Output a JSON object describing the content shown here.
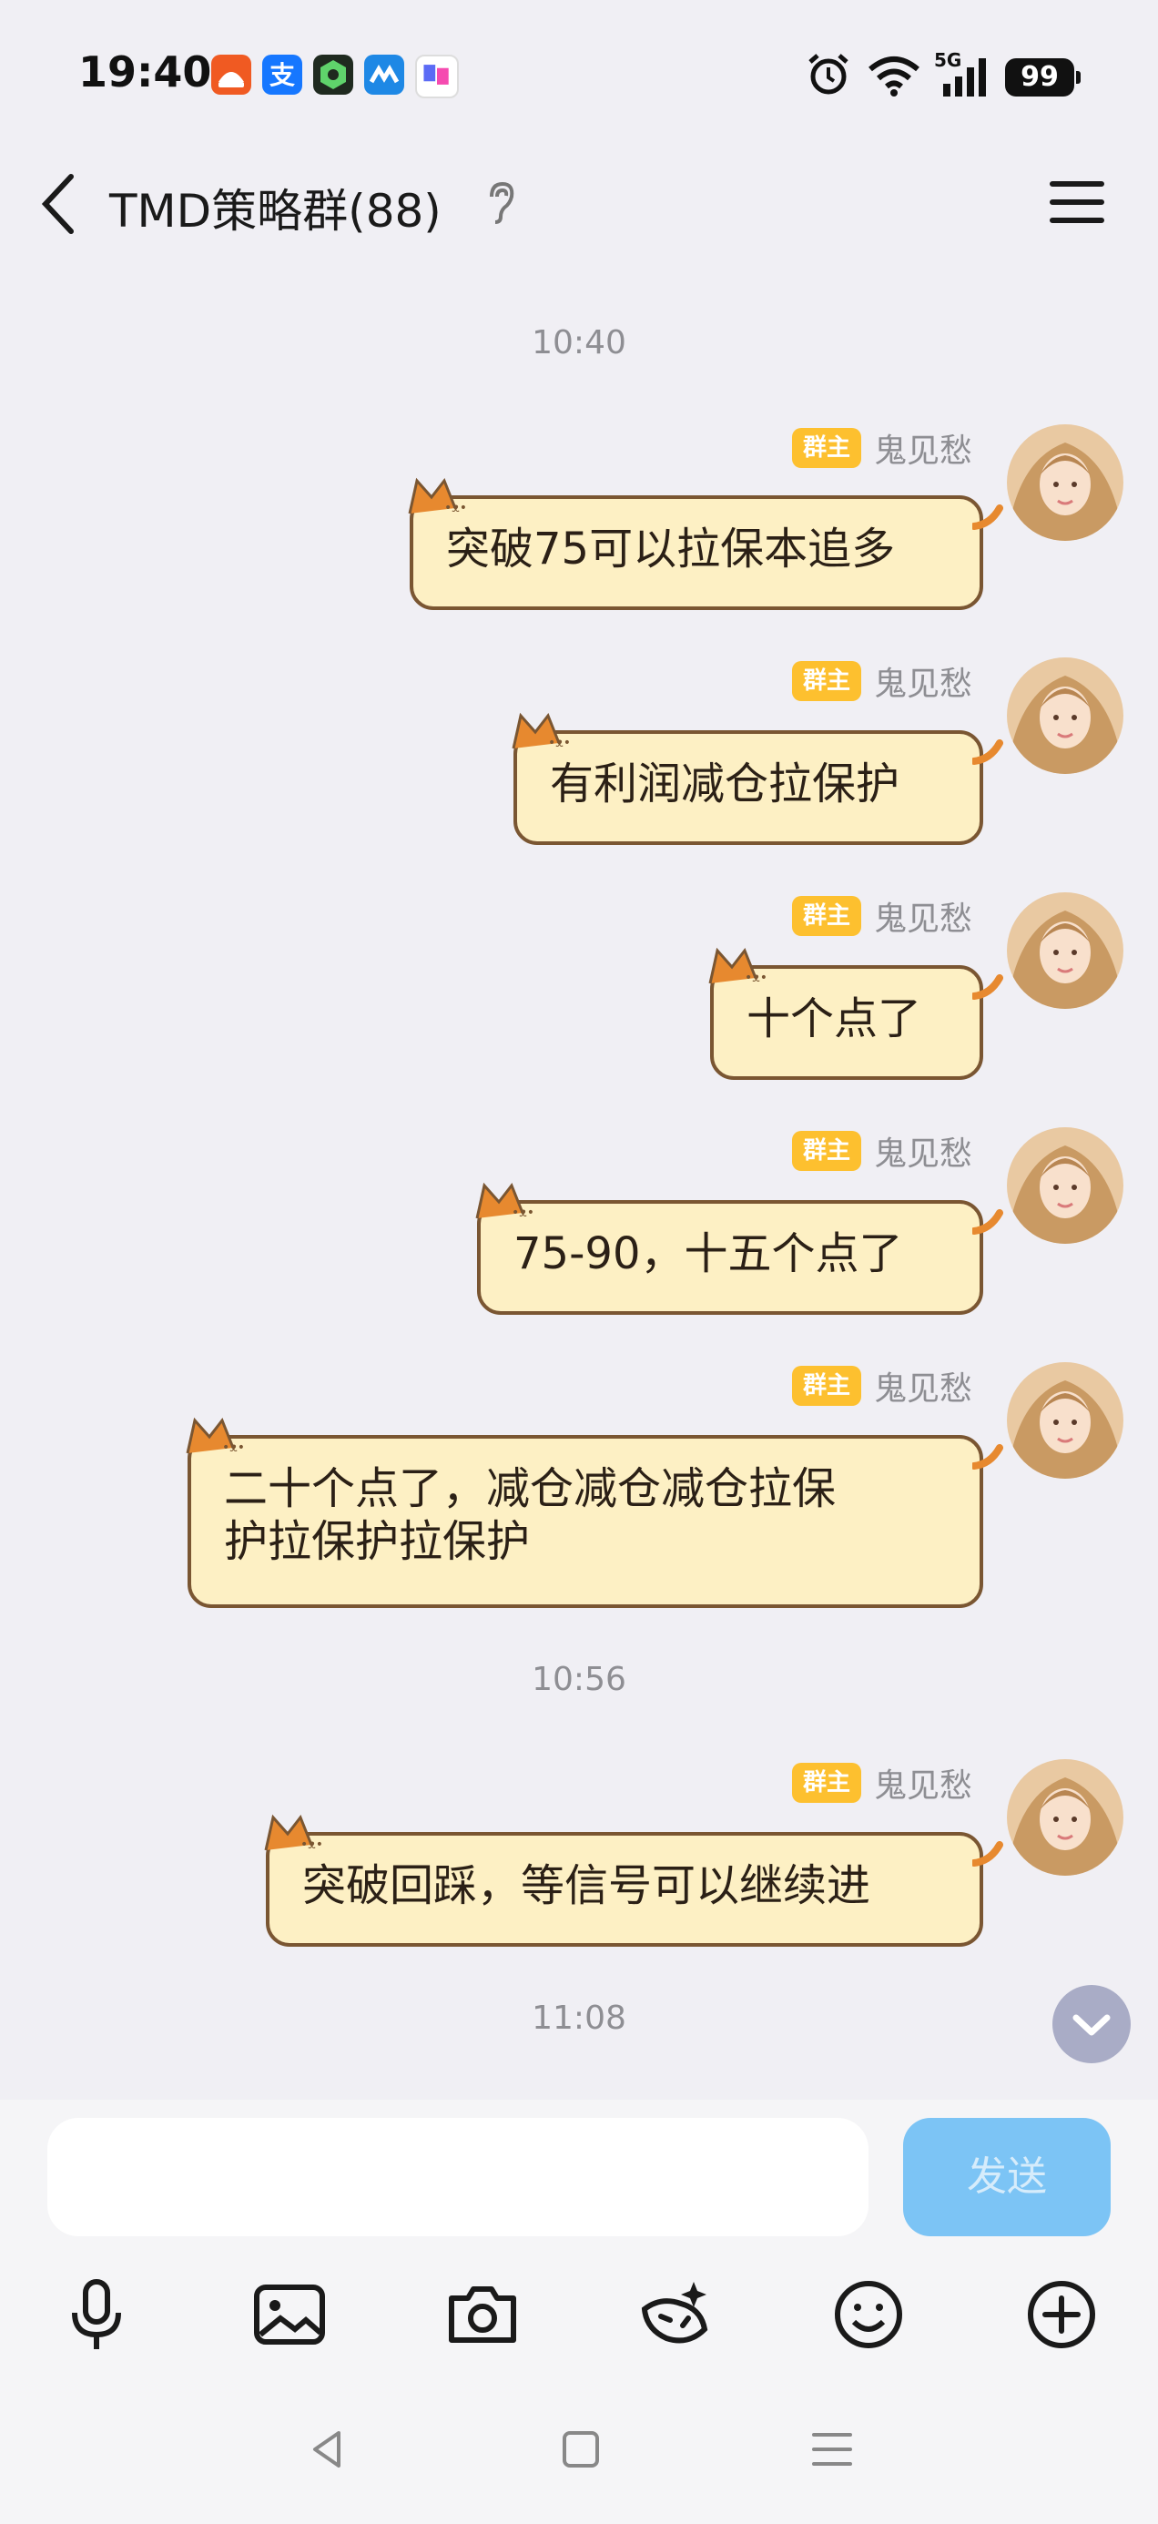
{
  "status_bar": {
    "time": "19:40",
    "battery": "99",
    "network": "5G",
    "app_icons": [
      "taobao-icon",
      "alipay-icon",
      "green-hex-app-icon",
      "blue-app-icon",
      "mixed-app-icon"
    ],
    "system_icons": [
      "alarm-icon",
      "wifi-icon",
      "signal-icon",
      "battery-icon"
    ]
  },
  "header": {
    "title": "TMD策略群(88)",
    "icons": [
      "back-icon",
      "ear-icon",
      "menu-icon"
    ]
  },
  "messages": [
    {
      "type": "time",
      "text": "10:40"
    },
    {
      "type": "msg",
      "badge": "群主",
      "sender": "鬼见愁",
      "text": "突破75可以拉保本追多"
    },
    {
      "type": "msg",
      "badge": "群主",
      "sender": "鬼见愁",
      "text": "有利润减仓拉保护"
    },
    {
      "type": "msg",
      "badge": "群主",
      "sender": "鬼见愁",
      "text": "十个点了"
    },
    {
      "type": "msg",
      "badge": "群主",
      "sender": "鬼见愁",
      "text": "75-90，十五个点了"
    },
    {
      "type": "msg",
      "badge": "群主",
      "sender": "鬼见愁",
      "text_line1": "二十个点了，减仓减仓减仓拉保",
      "text_line2": "护拉保护拉保护"
    },
    {
      "type": "time",
      "text": "10:56"
    },
    {
      "type": "msg",
      "badge": "群主",
      "sender": "鬼见愁",
      "text": "突破回踩，等信号可以继续进"
    },
    {
      "type": "time",
      "text": "11:08"
    }
  ],
  "composer": {
    "placeholder": "",
    "send_label": "发送",
    "tools": [
      "microphone-icon",
      "image-icon",
      "camera-icon",
      "sticker-icon",
      "emoji-icon",
      "plus-icon"
    ]
  },
  "nav_bar": [
    "back-triangle-icon",
    "home-square-icon",
    "recents-menu-icon"
  ],
  "colors": {
    "background": "#f0eff4",
    "bubble_fill": "#fdf0c4",
    "bubble_border": "#7a5632",
    "badge": "#fdc02f",
    "send_button": "#7cc4f5"
  }
}
